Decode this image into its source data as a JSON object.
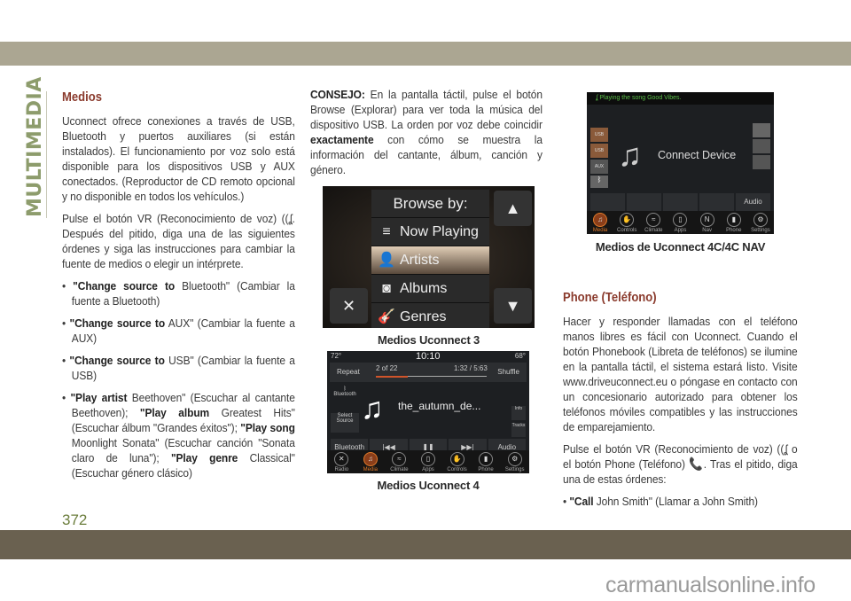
{
  "section_tab": "MULTIMEDIA",
  "page_number": "372",
  "watermark": "carmanualsonline.info",
  "colors": {
    "top_band": "#aba692",
    "bottom_band": "#6a6150",
    "heading": "#8a3a2c",
    "section_tab": "#8d9c6c"
  },
  "left": {
    "heading": "Medios",
    "p1": "Uconnect ofrece conexiones a través de USB, Bluetooth y puertos auxiliares (si están instalados). El funcionamiento por voz solo está disponible para los dispositivos USB y AUX conectados. (Reproductor de CD remoto opcional y no disponible en todos los vehículos.)",
    "p2a": "Pulse el botón VR (Reconocimiento de voz)",
    "p2b": ". Después del pitido, diga una de las siguientes órdenes y siga las instrucciones para cambiar la fuente de medios o elegir un intérprete.",
    "bullets": [
      {
        "b": "\"Change source to",
        "t": " Bluetooth\" (Cambiar la fuente a Bluetooth)"
      },
      {
        "b": "\"Change source to",
        "t": " AUX\" (Cambiar la fuente a AUX)"
      },
      {
        "b": "\"Change source to",
        "t": " USB\" (Cambiar la fuente a USB)"
      }
    ],
    "b4": [
      {
        "b": "\"Play artist",
        "t": " Beethoven\" (Escuchar al cantante Beethoven); "
      },
      {
        "b": "\"Play album",
        "t": " Greatest Hits\" (Escuchar álbum \"Grandes éxitos\"); "
      },
      {
        "b": "\"Play song",
        "t": " Moonlight Sonata\" (Escuchar canción \"Sonata claro de luna\"); "
      },
      {
        "b": "\"Play genre",
        "t": " Classical\" (Escuchar género clásico)"
      }
    ]
  },
  "middle": {
    "tip_label": "CONSEJO:",
    "tip_a": " En la pantalla táctil, pulse el botón Browse (Explorar) para ver toda la música del dispositivo USB. La orden por voz debe coincidir ",
    "tip_bold": "exactamente",
    "tip_b": " con cómo se muestra la información del cantante, álbum, canción y género.",
    "u3": {
      "title": "Browse by:",
      "items": [
        "Now Playing",
        "Artists",
        "Albums",
        "Genres"
      ],
      "selected": "Artists",
      "caption": "Medios Uconnect 3"
    },
    "u4": {
      "temp_left": "72°",
      "time": "10:10",
      "temp_right": "68°",
      "repeat": "Repeat",
      "track": "2 of 22",
      "elapsed": "1:32 / 5:63",
      "shuffle": "Shuffle",
      "source_icon_label": "Bluetooth",
      "select_source": "Select Source",
      "song": "the_autumn_de...",
      "info": "Info",
      "tracks": "Tracks",
      "controls": [
        "Bluetooth",
        "|◀◀",
        "❚❚",
        "▶▶|",
        "Audio"
      ],
      "nav": [
        "Radio",
        "Media",
        "Climate",
        "Apps",
        "Controls",
        "Phone",
        "Settings"
      ],
      "active": "Media",
      "progress": 0.29,
      "caption": "Medios Uconnect 4"
    }
  },
  "right": {
    "nav4c": {
      "status": "Playing the song Good Vibes.",
      "main": "Connect Device",
      "left_buttons": [
        "USB",
        "USB",
        "AUX"
      ],
      "audio": "Audio",
      "nav": [
        "Media",
        "Controls",
        "Climate",
        "Apps",
        "Nav",
        "Phone",
        "Settings"
      ],
      "active": "Media",
      "caption": "Medios de Uconnect 4C/4C NAV"
    },
    "heading": "Phone (Teléfono)",
    "p1": "Hacer y responder llamadas con el teléfono manos libres es fácil con Uconnect. Cuando el botón Phonebook (Libreta de teléfonos) se ilumine en la pantalla táctil, el sistema estará listo. Visite www.driveuconnect.eu o póngase en contacto con un concesionario autorizado para obtener los teléfonos móviles compatibles y las instrucciones de emparejamiento.",
    "p2a": "Pulse el botón VR (Reconocimiento de voz)",
    "p2b": " o el botón Phone (Teléfono)",
    "p2c": ". Tras el pitido, diga una de estas órdenes:",
    "bullet": {
      "b": "\"Call",
      "t": " John Smith\" (Llamar a John Smith)"
    }
  }
}
